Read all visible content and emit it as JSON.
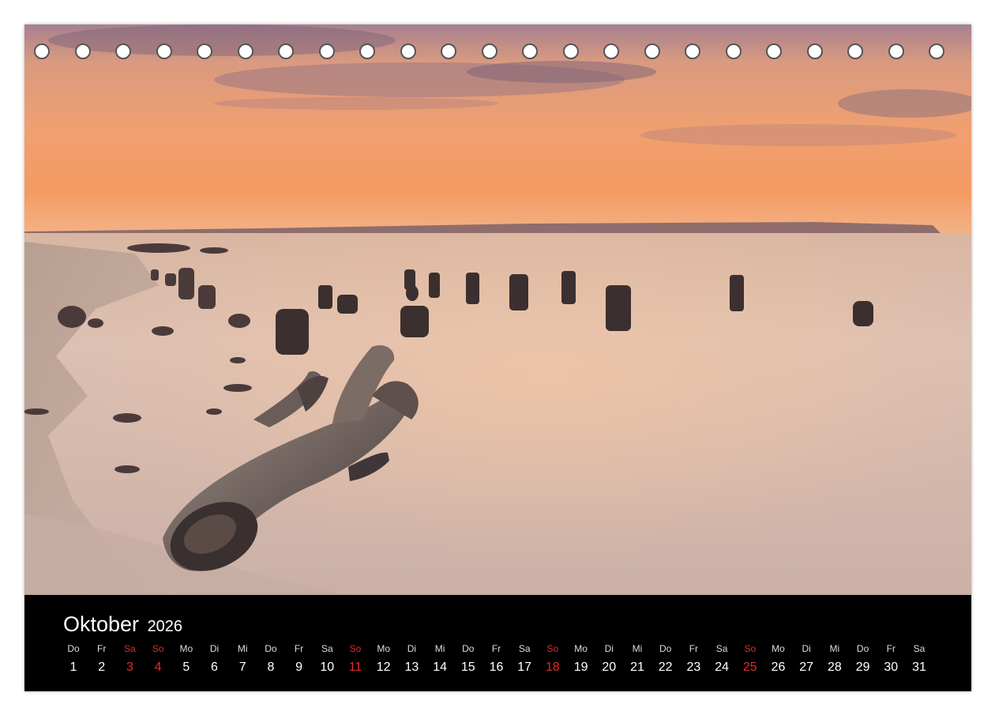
{
  "calendar": {
    "month": "Oktober",
    "year": "2026",
    "days": [
      {
        "wd": "Do",
        "num": "1",
        "red": false
      },
      {
        "wd": "Fr",
        "num": "2",
        "red": false
      },
      {
        "wd": "Sa",
        "num": "3",
        "red": true
      },
      {
        "wd": "So",
        "num": "4",
        "red": true
      },
      {
        "wd": "Mo",
        "num": "5",
        "red": false
      },
      {
        "wd": "Di",
        "num": "6",
        "red": false
      },
      {
        "wd": "Mi",
        "num": "7",
        "red": false
      },
      {
        "wd": "Do",
        "num": "8",
        "red": false
      },
      {
        "wd": "Fr",
        "num": "9",
        "red": false
      },
      {
        "wd": "Sa",
        "num": "10",
        "red": false
      },
      {
        "wd": "So",
        "num": "11",
        "red": true
      },
      {
        "wd": "Mo",
        "num": "12",
        "red": false
      },
      {
        "wd": "Di",
        "num": "13",
        "red": false
      },
      {
        "wd": "Mi",
        "num": "14",
        "red": false
      },
      {
        "wd": "Do",
        "num": "15",
        "red": false
      },
      {
        "wd": "Fr",
        "num": "16",
        "red": false
      },
      {
        "wd": "Sa",
        "num": "17",
        "red": false
      },
      {
        "wd": "So",
        "num": "18",
        "red": true
      },
      {
        "wd": "Mo",
        "num": "19",
        "red": false
      },
      {
        "wd": "Di",
        "num": "20",
        "red": false
      },
      {
        "wd": "Mi",
        "num": "21",
        "red": false
      },
      {
        "wd": "Do",
        "num": "22",
        "red": false
      },
      {
        "wd": "Fr",
        "num": "23",
        "red": false
      },
      {
        "wd": "Sa",
        "num": "24",
        "red": false
      },
      {
        "wd": "So",
        "num": "25",
        "red": true
      },
      {
        "wd": "Mo",
        "num": "26",
        "red": false
      },
      {
        "wd": "Di",
        "num": "27",
        "red": false
      },
      {
        "wd": "Mi",
        "num": "28",
        "red": false
      },
      {
        "wd": "Do",
        "num": "29",
        "red": false
      },
      {
        "wd": "Fr",
        "num": "30",
        "red": false
      },
      {
        "wd": "Sa",
        "num": "31",
        "red": false
      }
    ]
  },
  "colors": {
    "holiday": "#e02b2b",
    "strip": "#000000"
  }
}
